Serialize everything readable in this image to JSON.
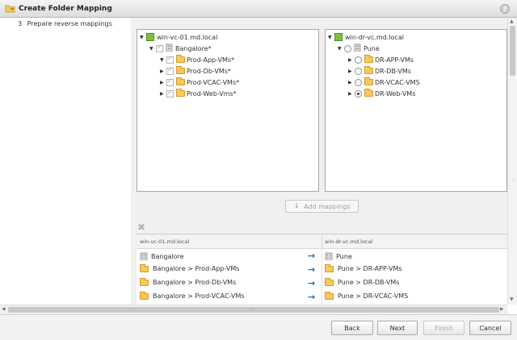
{
  "window": {
    "title": "Create Folder Mapping",
    "help_icon": "help-icon",
    "help_glyph": "?"
  },
  "steps": [
    {
      "number": "3",
      "label": "Prepare reverse mappings"
    }
  ],
  "source_tree": {
    "root": "win-vc-01.md.local",
    "datacenter": "Bangalore*",
    "folders": [
      "Prod-App-VMs*",
      "Prod-Db-VMs*",
      "Prod-VCAC-VMs*",
      "Prod-Web-Vms*"
    ]
  },
  "target_tree": {
    "root": "win-dr-vc.md.local",
    "datacenter": "Pune",
    "folders": [
      "DR-APP-VMs",
      "DR-DB-VMs",
      "DR-VCAC-VMS",
      "DR-Web-VMs"
    ],
    "selected": "DR-Web-VMs"
  },
  "add_mappings_label": "Add mappings",
  "mapping_table": {
    "columns": [
      "win-vc-01.md.local",
      "win-dr-vc.md.local"
    ],
    "rows": [
      {
        "source": "Bangalore",
        "target": "Pune",
        "source_icon": "datacenter",
        "target_icon": "datacenter"
      },
      {
        "source": "Bangalore > Prod-App-VMs",
        "target": "Pune > DR-APP-VMs",
        "source_icon": "folder",
        "target_icon": "folder"
      },
      {
        "source": "Bangalore > Prod-Db-VMs",
        "target": "Pune > DR-DB-VMs",
        "source_icon": "folder",
        "target_icon": "folder"
      },
      {
        "source": "Bangalore > Prod-VCAC-VMs",
        "target": "Pune > DR-VCAC-VMS",
        "source_icon": "folder",
        "target_icon": "folder"
      }
    ]
  },
  "footer": {
    "back": "Back",
    "next": "Next",
    "finish": "Finish",
    "cancel": "Cancel"
  },
  "colors": {
    "accent_arrow": "#1f6fb4",
    "folder": "#f6c95f",
    "vcenter": "#7cc242"
  }
}
